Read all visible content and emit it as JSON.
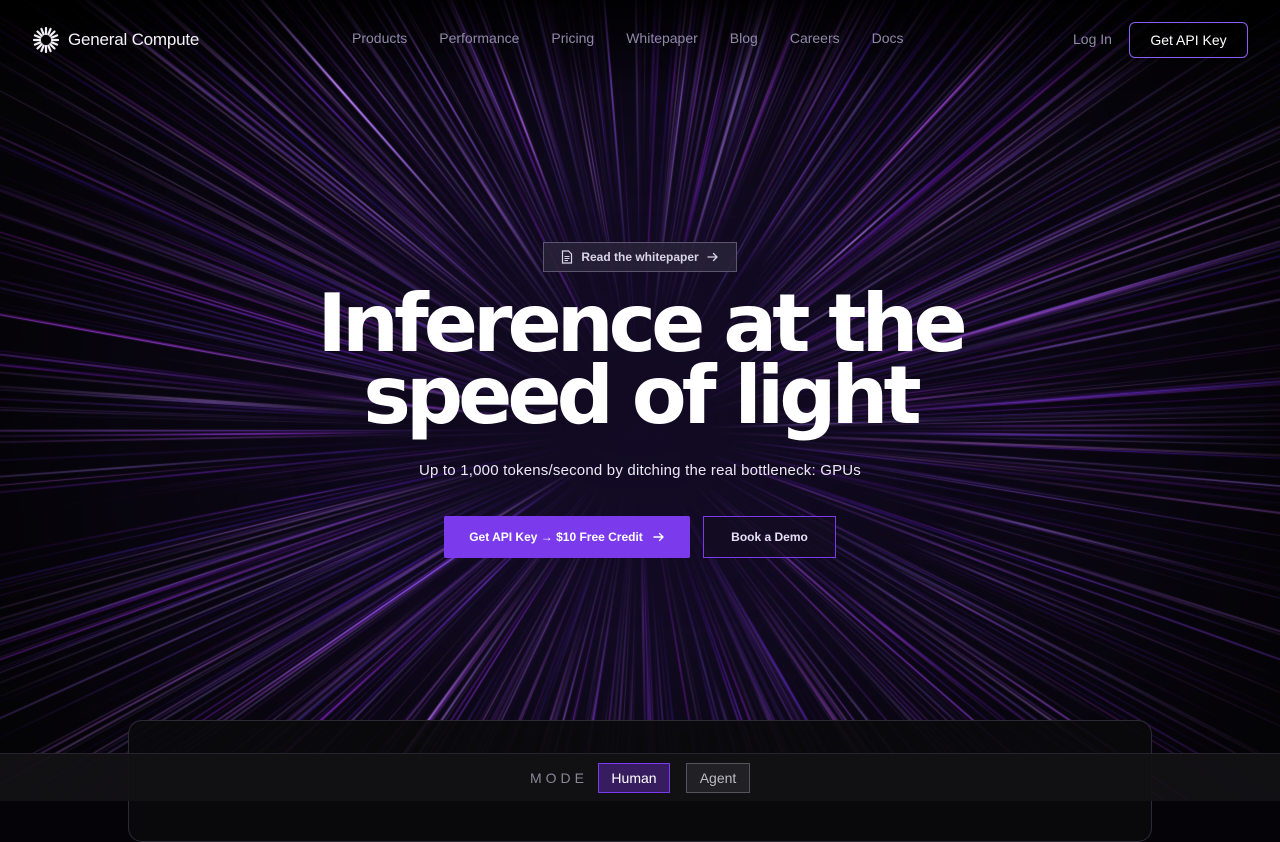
{
  "brand": {
    "name": "General Compute",
    "accent": "#7c3aed"
  },
  "nav": {
    "items": [
      "Products",
      "Performance",
      "Pricing",
      "Whitepaper",
      "Blog",
      "Careers",
      "Docs"
    ],
    "login": "Log In",
    "cta": "Get API Key"
  },
  "hero": {
    "pill": {
      "label": "Read the whitepaper",
      "icon": "document-icon"
    },
    "title_line1": "Inference at the",
    "title_line2": "speed of light",
    "subtitle": "Up to 1,000 tokens/second by ditching the real bottleneck: GPUs",
    "primary_cta": "Get API Key → $10 Free Credit",
    "secondary_cta": "Book a Demo"
  },
  "mode": {
    "label": "MODE",
    "options": [
      "Human",
      "Agent"
    ],
    "selected": "Human"
  }
}
